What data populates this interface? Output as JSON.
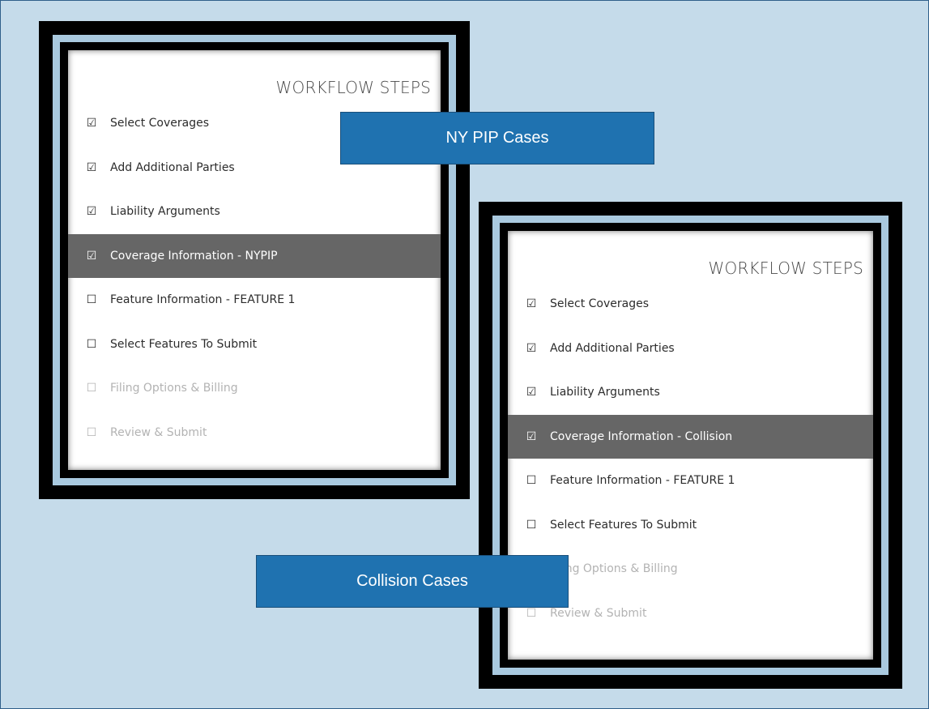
{
  "panels": [
    {
      "title": "WORKFLOW STEPS",
      "steps": [
        {
          "label": "Select Coverages",
          "check": "☑",
          "state": "done"
        },
        {
          "label": "Add Additional Parties",
          "check": "☑",
          "state": "done"
        },
        {
          "label": "Liability Arguments",
          "check": "☑",
          "state": "done"
        },
        {
          "label": "Coverage Information - NYPIP",
          "check": "☑",
          "state": "active"
        },
        {
          "label": "Feature Information - FEATURE 1",
          "check": "☐",
          "state": "todo"
        },
        {
          "label": "Select Features To Submit",
          "check": "☐",
          "state": "todo"
        },
        {
          "label": "Filing Options & Billing",
          "check": "☐",
          "state": "disabled"
        },
        {
          "label": "Review & Submit",
          "check": "☐",
          "state": "disabled"
        }
      ]
    },
    {
      "title": "WORKFLOW STEPS",
      "steps": [
        {
          "label": "Select Coverages",
          "check": "☑",
          "state": "done"
        },
        {
          "label": "Add Additional Parties",
          "check": "☑",
          "state": "done"
        },
        {
          "label": "Liability Arguments",
          "check": "☑",
          "state": "done"
        },
        {
          "label": "Coverage Information - Collision",
          "check": "☑",
          "state": "active"
        },
        {
          "label": "Feature Information - FEATURE 1",
          "check": "☐",
          "state": "todo"
        },
        {
          "label": "Select Features To Submit",
          "check": "☐",
          "state": "todo"
        },
        {
          "label": "Filing Options & Billing",
          "check": "☐",
          "state": "disabled"
        },
        {
          "label": "Review & Submit",
          "check": "☐",
          "state": "disabled"
        }
      ]
    }
  ],
  "callouts": {
    "ny_pip": "NY PIP Cases",
    "collision": "Collision Cases"
  },
  "colors": {
    "background": "#c5dbea",
    "active_step": "#666666",
    "callout": "#1f72b0"
  }
}
